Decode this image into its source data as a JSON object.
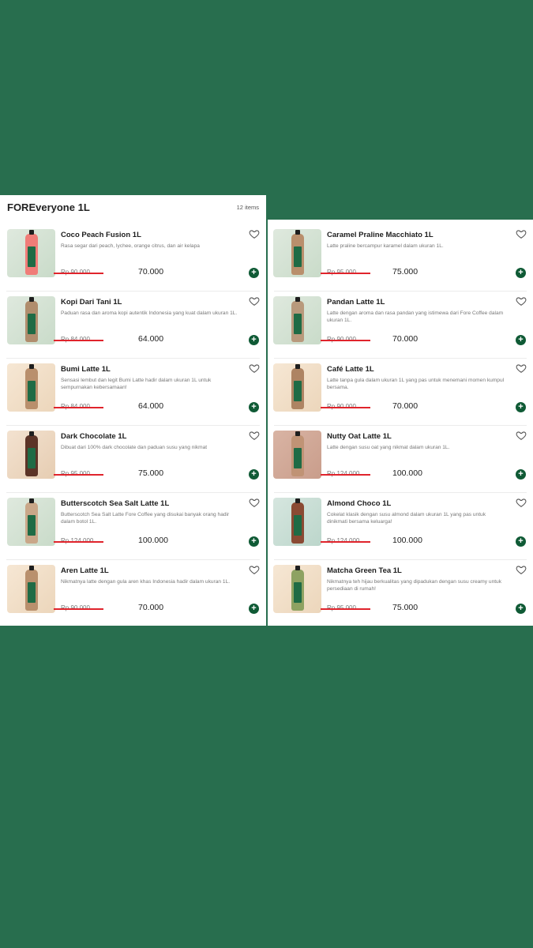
{
  "header": {
    "title": "FOREveryone 1L",
    "count": "12 items"
  },
  "colors": {
    "accent": "#0f5a35",
    "strike": "#e0242c",
    "background": "#286e4e"
  },
  "left_items": [
    {
      "name": "Coco Peach Fusion 1L",
      "desc": "Rasa segar dari peach, lychee, orange citrus, dan air kelapa",
      "old_price": "Rp 90.000",
      "price": "70.000"
    },
    {
      "name": "Kopi Dari Tani 1L",
      "desc": "Paduan rasa dan aroma kopi autentik Indonesia yang kuat dalam ukuran 1L.",
      "old_price": "Rp 84.000",
      "price": "64.000"
    },
    {
      "name": "Bumi Latte 1L",
      "desc": "Sensasi lembut dan legit Bumi Latte hadir dalam ukuran 1L untuk sempurnakan kebersamaan!",
      "old_price": "Rp 84.000",
      "price": "64.000"
    },
    {
      "name": "Dark Chocolate 1L",
      "desc": "Dibuat dari 100% dark chocolate dan paduan susu yang nikmat",
      "old_price": "Rp 95.000",
      "price": "75.000"
    },
    {
      "name": "Butterscotch Sea Salt Latte 1L",
      "desc": "Butterscotch Sea Salt Latte Fore Coffee yang disukai banyak orang hadir dalam botol 1L.",
      "old_price": "Rp 124.000",
      "price": "100.000"
    },
    {
      "name": "Aren Latte 1L",
      "desc": "Nikmatnya latte dengan gula aren khas Indonesia hadir dalam ukuran 1L.",
      "old_price": "Rp 90.000",
      "price": "70.000"
    }
  ],
  "right_items": [
    {
      "name": "Caramel Praline Macchiato 1L",
      "desc": "Latte praline bercampur karamel dalam ukuran 1L.",
      "old_price": "Rp 95.000",
      "price": "75.000"
    },
    {
      "name": "Pandan Latte 1L",
      "desc": "Latte dengan aroma dan rasa pandan yang istimewa dari Fore Coffee dalam ukuran 1L.",
      "old_price": "Rp 90.000",
      "price": "70.000"
    },
    {
      "name": "Café Latte 1L",
      "desc": "Latte tanpa gula dalam ukuran 1L yang pas untuk menemani momen kumpul bersama.",
      "old_price": "Rp 90.000",
      "price": "70.000"
    },
    {
      "name": "Nutty Oat Latte 1L",
      "desc": "Latte dengan susu oat yang nikmat dalam ukuran 1L.",
      "old_price": "Rp 124.000",
      "price": "100.000"
    },
    {
      "name": "Almond Choco 1L",
      "desc": "Cokelat klasik dengan susu almond dalam ukuran 1L yang pas untuk dinikmati bersama keluarga!",
      "old_price": "Rp 124.000",
      "price": "100.000"
    },
    {
      "name": "Matcha Green Tea 1L",
      "desc": "Nikmatnya teh hijau berkualitas yang dipadukan dengan susu creamy untuk persediaan di rumah!",
      "old_price": "Rp 95.000",
      "price": "75.000"
    }
  ],
  "icons": {
    "favorite": "heart-outline-icon",
    "add": "plus-icon"
  }
}
